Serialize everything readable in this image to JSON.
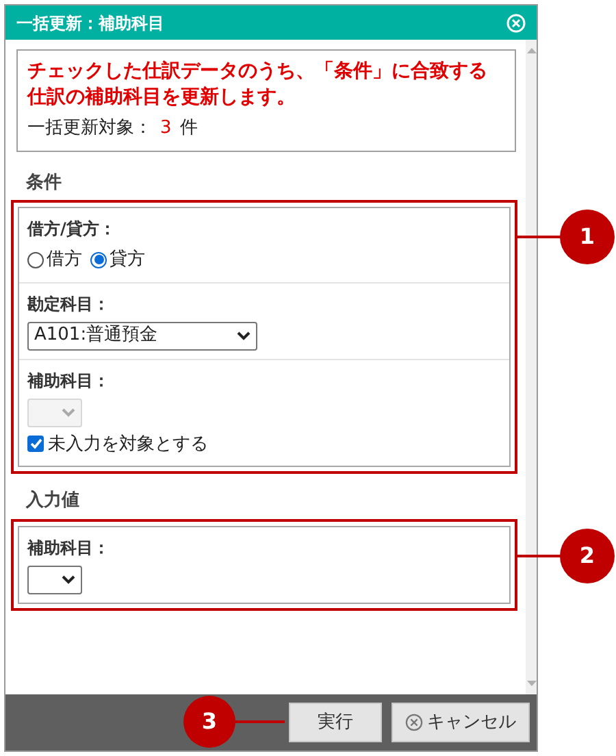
{
  "window": {
    "title": "一括更新：補助科目"
  },
  "notice": {
    "message": "チェックした仕訳データのうち、「条件」に合致する仕訳の補助科目を更新します。",
    "count_label": "一括更新対象：",
    "count": "3",
    "unit": "件"
  },
  "sections": [
    {
      "title": "条件",
      "callout": "1",
      "fields": [
        {
          "kind": "radio",
          "label": "借方/貸方：",
          "options": [
            {
              "label": "借方",
              "selected": false
            },
            {
              "label": "貸方",
              "selected": true
            }
          ]
        },
        {
          "kind": "select",
          "label": "勘定科目：",
          "value": "A101:普通預金",
          "disabled": false
        },
        {
          "kind": "select",
          "label": "補助科目：",
          "disabled": true,
          "checkbox": {
            "label": "未入力を対象とする",
            "checked": true
          }
        }
      ]
    },
    {
      "title": "入力値",
      "callout": "2",
      "fields": [
        {
          "kind": "select",
          "label": "補助科目：",
          "disabled": false
        }
      ]
    }
  ],
  "buttons": [
    {
      "kind": "primary",
      "label": "実行",
      "callout": "3"
    },
    {
      "kind": "cancel",
      "label": "キャンセル"
    }
  ]
}
